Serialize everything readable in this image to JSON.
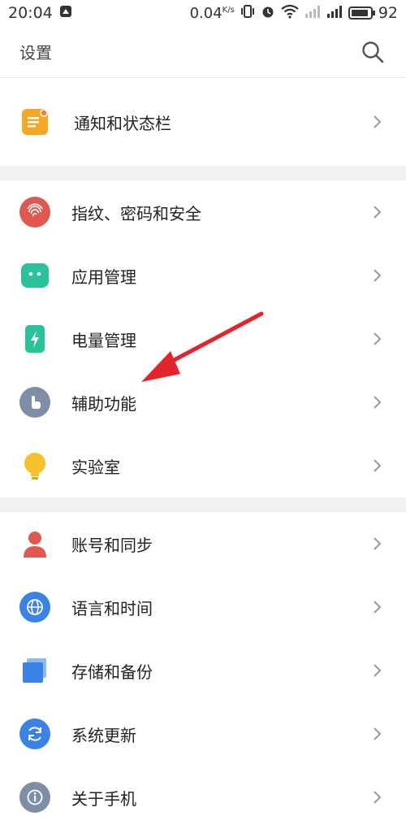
{
  "status": {
    "time": "20:04",
    "net_speed": "0.04",
    "net_unit": "K/s",
    "battery": "92"
  },
  "header": {
    "title": "设置"
  },
  "groups": [
    {
      "items": [
        {
          "label": "通知和状态栏",
          "icon": "notification-icon",
          "color": "#f5a623"
        }
      ]
    },
    {
      "items": [
        {
          "label": "指纹、密码和安全",
          "icon": "fingerprint-icon",
          "color": "#e0584f"
        },
        {
          "label": "应用管理",
          "icon": "android-icon",
          "color": "#2bc19a"
        },
        {
          "label": "电量管理",
          "icon": "battery-icon",
          "color": "#2bc19a"
        },
        {
          "label": "辅助功能",
          "icon": "hand-pointer-icon",
          "color": "#7d8ea6"
        },
        {
          "label": "实验室",
          "icon": "lightbulb-icon",
          "color": "#f6c12a"
        }
      ]
    },
    {
      "items": [
        {
          "label": "账号和同步",
          "icon": "person-icon",
          "color": "#e0584f"
        },
        {
          "label": "语言和时间",
          "icon": "globe-icon",
          "color": "#3b82e6"
        },
        {
          "label": "存储和备份",
          "icon": "storage-icon",
          "color": "#3b82e6"
        },
        {
          "label": "系统更新",
          "icon": "refresh-icon",
          "color": "#3b82e6"
        },
        {
          "label": "关于手机",
          "icon": "info-icon",
          "color": "#7d8ea6"
        }
      ]
    }
  ],
  "annotation": {
    "arrow_color": "#e3242b"
  }
}
